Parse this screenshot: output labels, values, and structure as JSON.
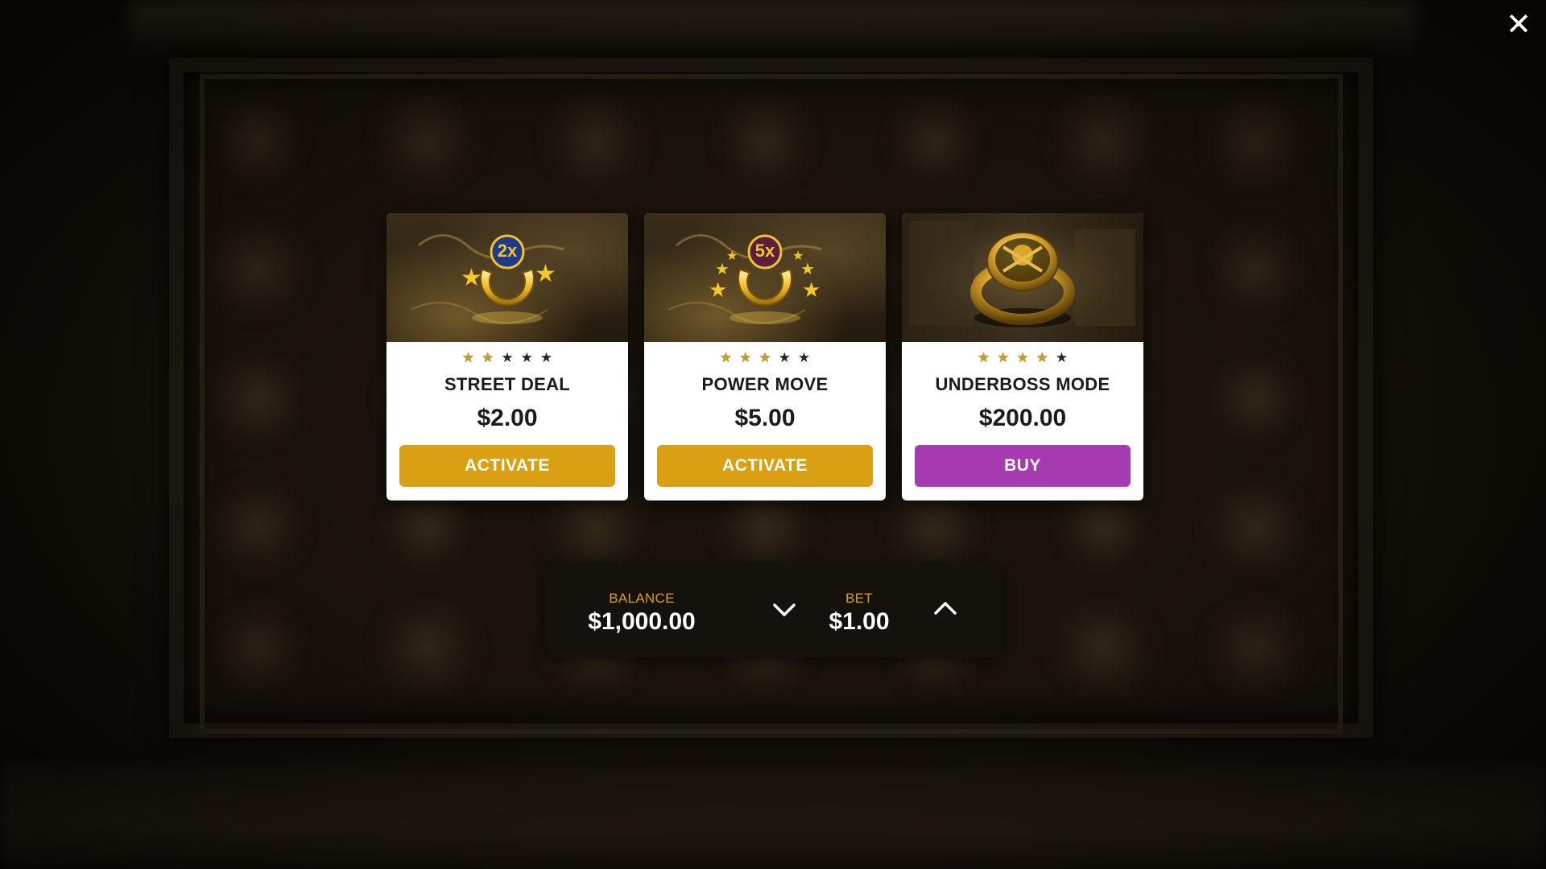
{
  "close": {
    "icon": "close-icon",
    "glyph": "✕"
  },
  "cards": [
    {
      "title": "STREET DEAL",
      "price": "$2.00",
      "button_label": "ACTIVATE",
      "button_color": "#d9a013",
      "stars_filled": 2,
      "stars_total": 5,
      "badge": "2x",
      "art": "golden-horseshoe-2x"
    },
    {
      "title": "POWER MOVE",
      "price": "$5.00",
      "button_label": "ACTIVATE",
      "button_color": "#d9a013",
      "stars_filled": 3,
      "stars_total": 5,
      "badge": "5x",
      "art": "golden-horseshoe-5x"
    },
    {
      "title": "UNDERBOSS MODE",
      "price": "$200.00",
      "button_label": "BUY",
      "button_color": "#a63ab0",
      "stars_filled": 4,
      "stars_total": 5,
      "art": "golden-signet-ring"
    }
  ],
  "bet_bar": {
    "balance_label": "BALANCE",
    "balance_value": "$1,000.00",
    "bet_label": "BET",
    "bet_value": "$1.00",
    "decrease_icon": "chevron-down-icon",
    "increase_icon": "chevron-up-icon"
  },
  "colors": {
    "accent_gold": "#d9a013",
    "buy_purple": "#a63ab0",
    "star_gold": "#c89a2a",
    "panel_dark": "#15110c"
  }
}
